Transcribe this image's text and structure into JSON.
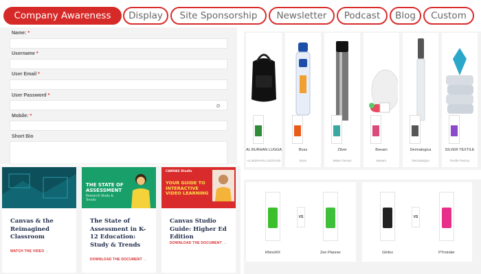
{
  "tabs": [
    {
      "label": "Company Awareness",
      "active": true
    },
    {
      "label": "Display",
      "active": false
    },
    {
      "label": "Site Sponsorship",
      "active": false
    },
    {
      "label": "Newsletter",
      "active": false
    },
    {
      "label": "Podcast",
      "active": false
    },
    {
      "label": "Blog",
      "active": false
    },
    {
      "label": "Custom",
      "active": false
    }
  ],
  "form": {
    "name_label": "Name:",
    "username_label": "Username",
    "email_label": "User Email",
    "password_label": "User Password",
    "mobile_label": "Mobile:",
    "bio_label": "Short Bio",
    "required_mark": "*",
    "password_toggle_icon": "eye-slash-icon"
  },
  "products": [
    {
      "name": "AL BURHAN LUGGAGE",
      "subtitle": "AL BURHAN LUGGAGE",
      "image": "black-backpack",
      "logo_color": "#2e8b3a"
    },
    {
      "name": "Boss",
      "subtitle": "Boss",
      "image": "water-bottle",
      "logo_color": "#e85c1a"
    },
    {
      "name": "Zilver",
      "subtitle": "Water Genius",
      "image": "thermos-bottle",
      "logo_color": "#3aa7a0"
    },
    {
      "name": "Beeam",
      "subtitle": "Beeam",
      "image": "white-device",
      "logo_color": "#d94b7b"
    },
    {
      "name": "Dermalogica",
      "subtitle": "Dermalogica",
      "image": "tube-pen",
      "logo_color": "#555555"
    },
    {
      "name": "SILVER TEXTILE",
      "subtitle": "Textile Factory",
      "image": "folded-towels",
      "logo_color": "#8a4ac9"
    }
  ],
  "resources": [
    {
      "title": "Canvas & the Reimagined Classroom",
      "link": "WATCH THE VIDEO →",
      "image_bg": "#0f5a66"
    },
    {
      "title": "The State of Assessment in K-12 Education: Study & Trends",
      "link": "DOWNLOAD THE DOCUMENT →",
      "image_bg": "#19a06a",
      "image_heading": "THE STATE OF ASSESSMENT",
      "image_sub": "Research Study & Trends"
    },
    {
      "title": "Canvas Studio Guide: Higher Ed Edition",
      "link": "DOWNLOAD THE DOCUMENT →",
      "image_bg": "#d92b2b",
      "image_badge": "CANVAS Studio",
      "image_heading": "YOUR GUIDE TO INTERACTIVE VIDEO LEARNING"
    }
  ],
  "compare": [
    {
      "left": "RhinoRX",
      "right": "Zen Planner",
      "vs": "VS",
      "left_color": "#3bbf2a",
      "right_color": "#3fbf3a"
    },
    {
      "left": "Glofox",
      "right": "PTminder",
      "vs": "VS",
      "left_color": "#222222",
      "right_color": "#e8308a"
    }
  ],
  "colors": {
    "accent": "#d92b2b",
    "panel": "#f3f3f3"
  }
}
